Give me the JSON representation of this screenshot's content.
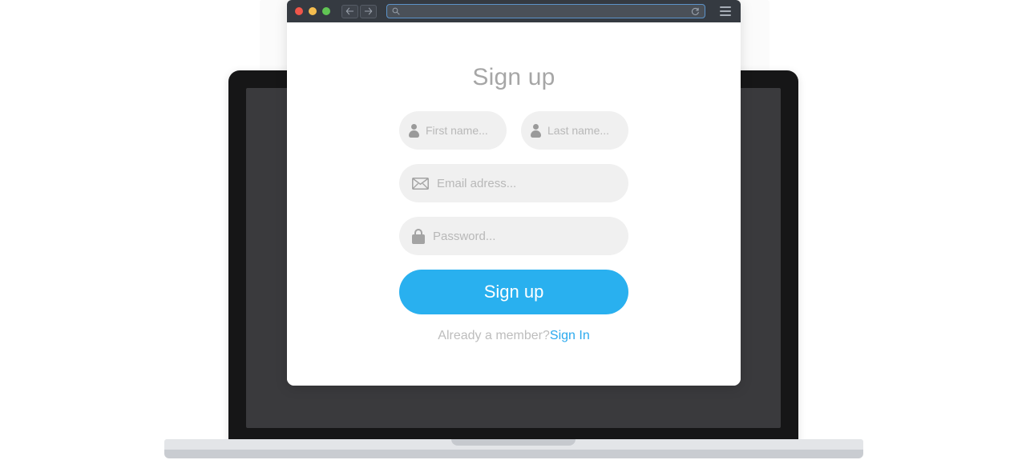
{
  "browser": {
    "traffic_lights": [
      {
        "name": "close",
        "color": "#f0564a"
      },
      {
        "name": "minimize",
        "color": "#f4bd4f"
      },
      {
        "name": "maximize",
        "color": "#61c554"
      }
    ],
    "back_label": "←",
    "forward_label": "→",
    "url_value": "",
    "url_placeholder": "",
    "search_icon": "magnifier-icon",
    "reload_icon": "reload-icon",
    "menu_icon": "hamburger-menu-icon"
  },
  "page": {
    "title": "Sign up",
    "fields": [
      {
        "icon": "person-icon",
        "placeholder": "First name...",
        "value": "",
        "name": "first-name"
      },
      {
        "icon": "person-icon",
        "placeholder": "Last name...",
        "value": "",
        "name": "last-name"
      },
      {
        "icon": "envelope-icon",
        "placeholder": "Email adress...",
        "value": "",
        "name": "email"
      },
      {
        "icon": "lock-icon",
        "placeholder": "Password...",
        "value": "",
        "name": "password"
      }
    ],
    "submit_label": "Sign up",
    "footer": {
      "text": "Already a member?",
      "link_label": "Sign In"
    }
  },
  "colors": {
    "accent": "#29b0ef",
    "link": "#2aa9ee",
    "field_bg": "#f0f0f0",
    "placeholder": "#b8b8b8",
    "title": "#a6a6a6",
    "chrome": "#353a41",
    "laptop_bezel": "#161617",
    "laptop_screen": "#3a3a3d",
    "laptop_base": "#e3e5e8"
  }
}
